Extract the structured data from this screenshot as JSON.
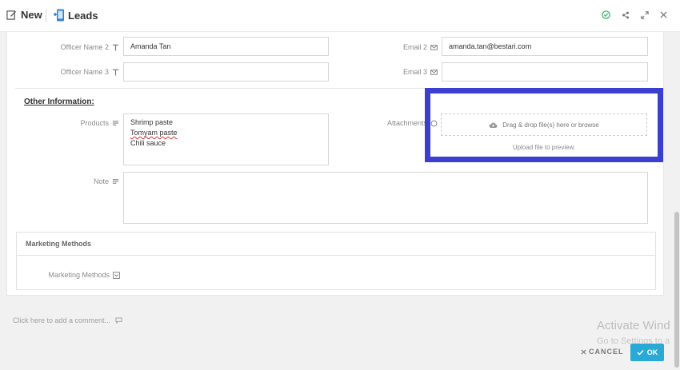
{
  "header": {
    "new_label": "New",
    "module_label": "Leads",
    "actions": [
      "check-circle-icon",
      "share-icon",
      "expand-icon",
      "close-icon"
    ],
    "colors": {
      "check": "#3cb371"
    }
  },
  "fields": {
    "officer_name_2": {
      "label": "Officer Name 2",
      "value": "Amanda Tan"
    },
    "officer_name_3": {
      "label": "Officer Name 3",
      "value": ""
    },
    "email_2": {
      "label": "Email 2",
      "value": "amanda.tan@bestari.com"
    },
    "email_3": {
      "label": "Email 3",
      "value": ""
    }
  },
  "other_info": {
    "title": "Other Information:",
    "products_label": "Products",
    "products_lines": [
      "Shrimp paste",
      "Tomyam paste",
      "Chili sauce"
    ],
    "attachments_label": "Attachments",
    "dropzone_text": "Drag & drop file(s) here or browse",
    "upload_note": "Upload file to preview.",
    "note_label": "Note",
    "note_value": ""
  },
  "marketing": {
    "section_title": "Marketing Methods",
    "field_label": "Marketing Methods"
  },
  "comment_placeholder": "Click here to add a comment...",
  "footer": {
    "cancel_label": "CANCEL",
    "ok_label": "OK",
    "ok_color": "#29a9d6"
  },
  "watermark": {
    "line1": "Activate Wind",
    "line2": "Go to Settings to a"
  },
  "highlight_color": "#3a3fcf"
}
